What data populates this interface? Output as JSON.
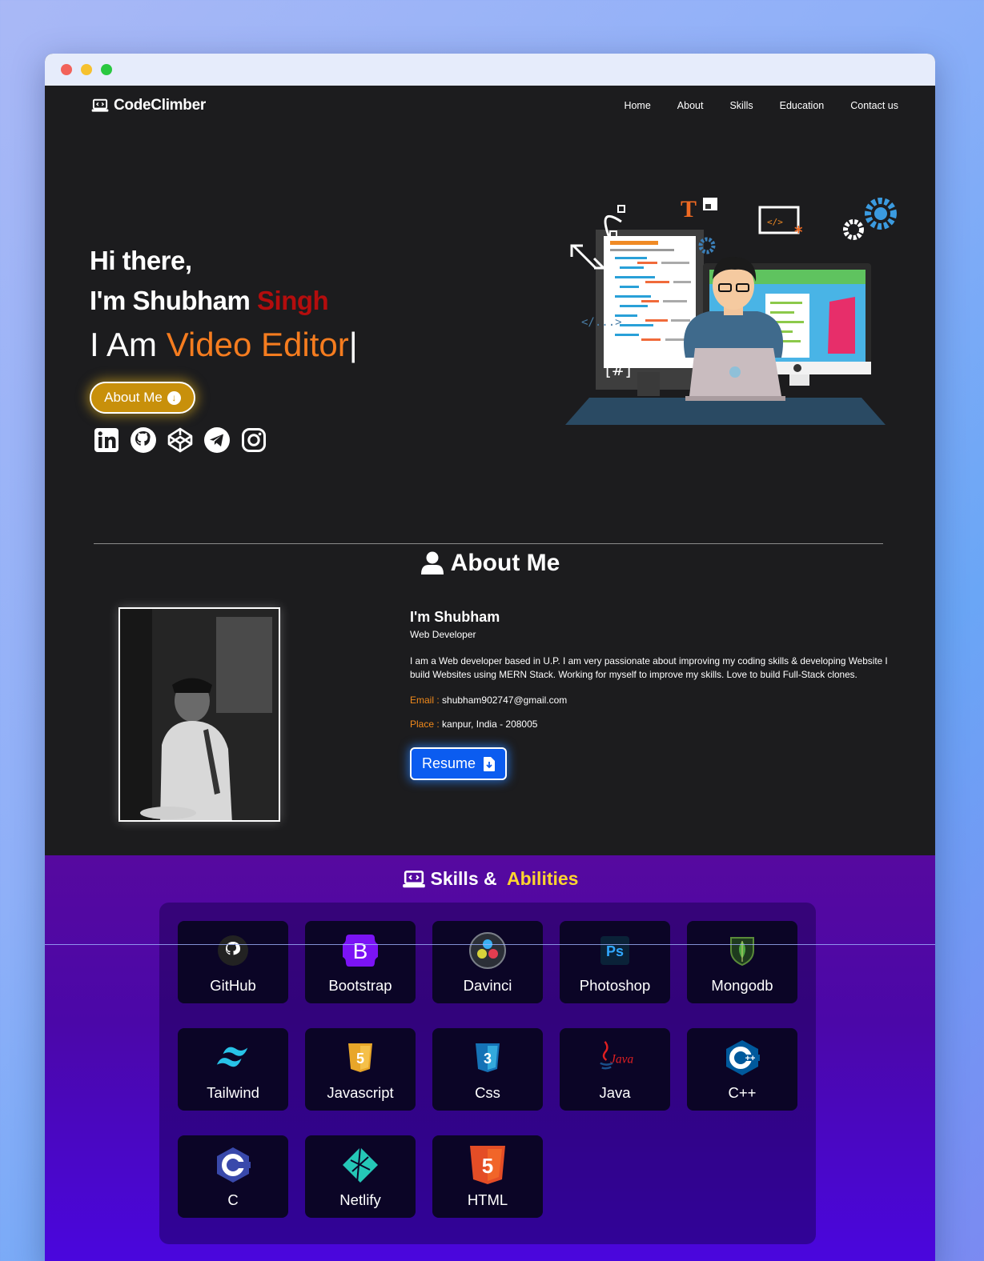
{
  "brand": {
    "name": "CodeClimber"
  },
  "nav": {
    "items": [
      "Home",
      "About",
      "Skills",
      "Education",
      "Contact us"
    ]
  },
  "hero": {
    "greeting": "Hi there,",
    "name_prefix": "I'm Shubham ",
    "name_highlight": "Singh",
    "role_prefix": "I Am ",
    "role_highlight": "Video Editor",
    "cursor": "|",
    "about_button": "About Me",
    "socials": [
      "linkedin-icon",
      "github-icon",
      "codepen-icon",
      "telegram-icon",
      "instagram-icon"
    ]
  },
  "about": {
    "title": "About Me",
    "heading": "I'm Shubham",
    "subtitle": "Web Developer",
    "description": "I am a Web developer based in U.P. I am very passionate about improving my coding skills & developing Website I build Websites using MERN Stack. Working for myself to improve my skills. Love to build Full-Stack clones.",
    "email_label": "Email :",
    "email": "shubham902747@gmail.com",
    "place_label": "Place :",
    "place": "kanpur, India - 208005",
    "resume_button": "Resume"
  },
  "skills": {
    "title_prefix": "Skills & ",
    "title_highlight": "Abilities",
    "items": [
      "GitHub",
      "Bootstrap",
      "Davinci",
      "Photoshop",
      "Mongodb",
      "Tailwind",
      "Javascript",
      "Css",
      "Java",
      "C++",
      "C",
      "Netlify",
      "HTML"
    ]
  },
  "colors": {
    "accent_orange": "#f57c1f",
    "name_red": "#b40d0d",
    "button_gold": "#c8900b",
    "resume_blue": "#0b5cf0",
    "abilities_yellow": "#ffd52e"
  }
}
